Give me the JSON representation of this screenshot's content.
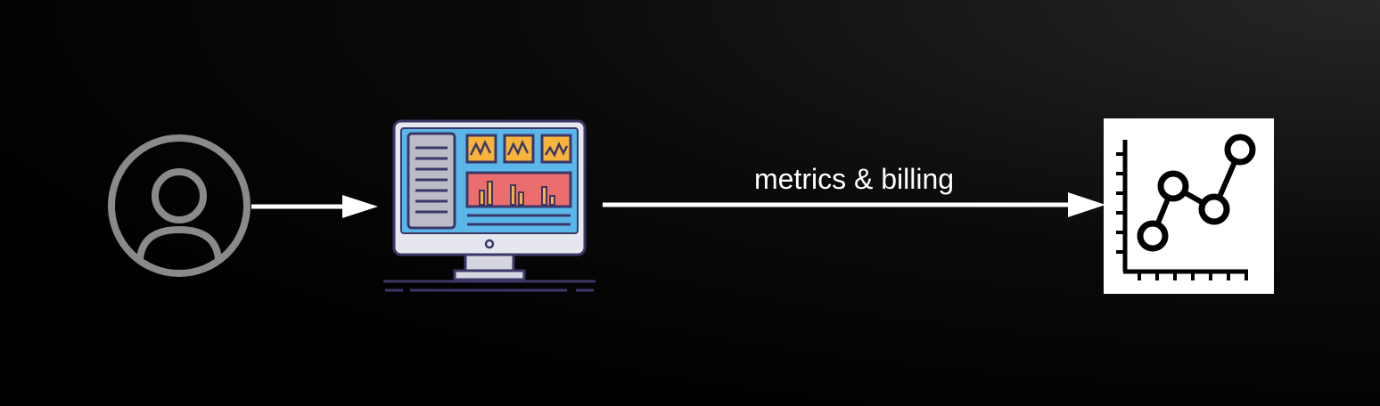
{
  "edges": [
    {
      "from": "user",
      "to": "application",
      "label": ""
    },
    {
      "from": "application",
      "to": "metrics",
      "label": "metrics & billing"
    }
  ],
  "icons": {
    "user": "user-circle-icon",
    "application": "monitor-dashboard-icon",
    "metrics": "line-chart-icon"
  },
  "colors": {
    "background": "#000000",
    "arrow": "#ffffff",
    "user_icon": "#8a8a8a",
    "monitor_frame": "#3b3768",
    "monitor_screen": "#5bb7ea",
    "monitor_panel": "#eb6d6d",
    "monitor_tile": "#f7b33b"
  }
}
